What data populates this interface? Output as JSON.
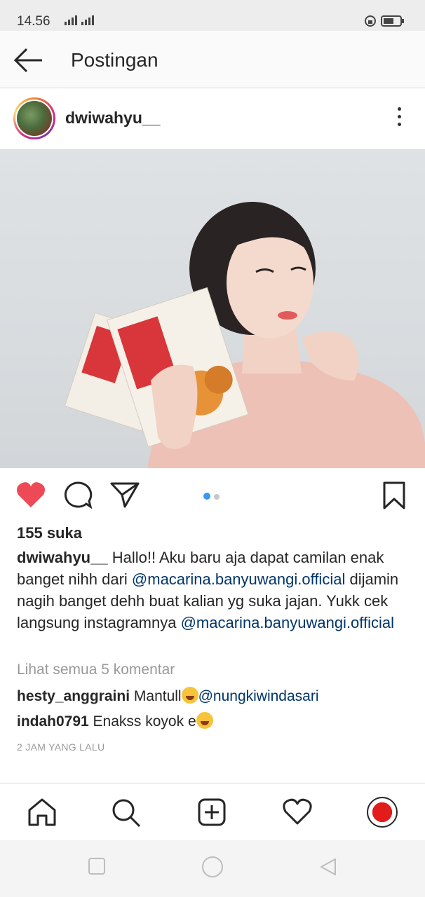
{
  "status_bar": {
    "time": "14.56"
  },
  "top_bar": {
    "title": "Postingan"
  },
  "post": {
    "username": "dwiwahyu__",
    "likes": "155 suka",
    "caption": {
      "username": "dwiwahyu__",
      "text_1": " Hallo!! Aku baru aja dapat camilan  enak banget nihh dari ",
      "mention_1": "@macarina.banyuwangi.official",
      "text_2": " dijamin nagih banget dehh buat kalian yg suka jajan. Yukk cek langsung instagramnya ",
      "mention_2": "@macarina.banyuwangi.official"
    },
    "view_all_comments": "Lihat semua 5 komentar",
    "comments": [
      {
        "username": "hesty_anggraini",
        "text": " Mantull",
        "mention": "@nungkiwindasari"
      },
      {
        "username": "indah0791",
        "text": " Enakss koyok e"
      }
    ],
    "timestamp": "2 JAM YANG LALU",
    "carousel": {
      "count": 2,
      "active": 1
    }
  },
  "colors": {
    "like": "#ed4956",
    "mention": "#003569",
    "carousel_active": "#3897f0"
  }
}
